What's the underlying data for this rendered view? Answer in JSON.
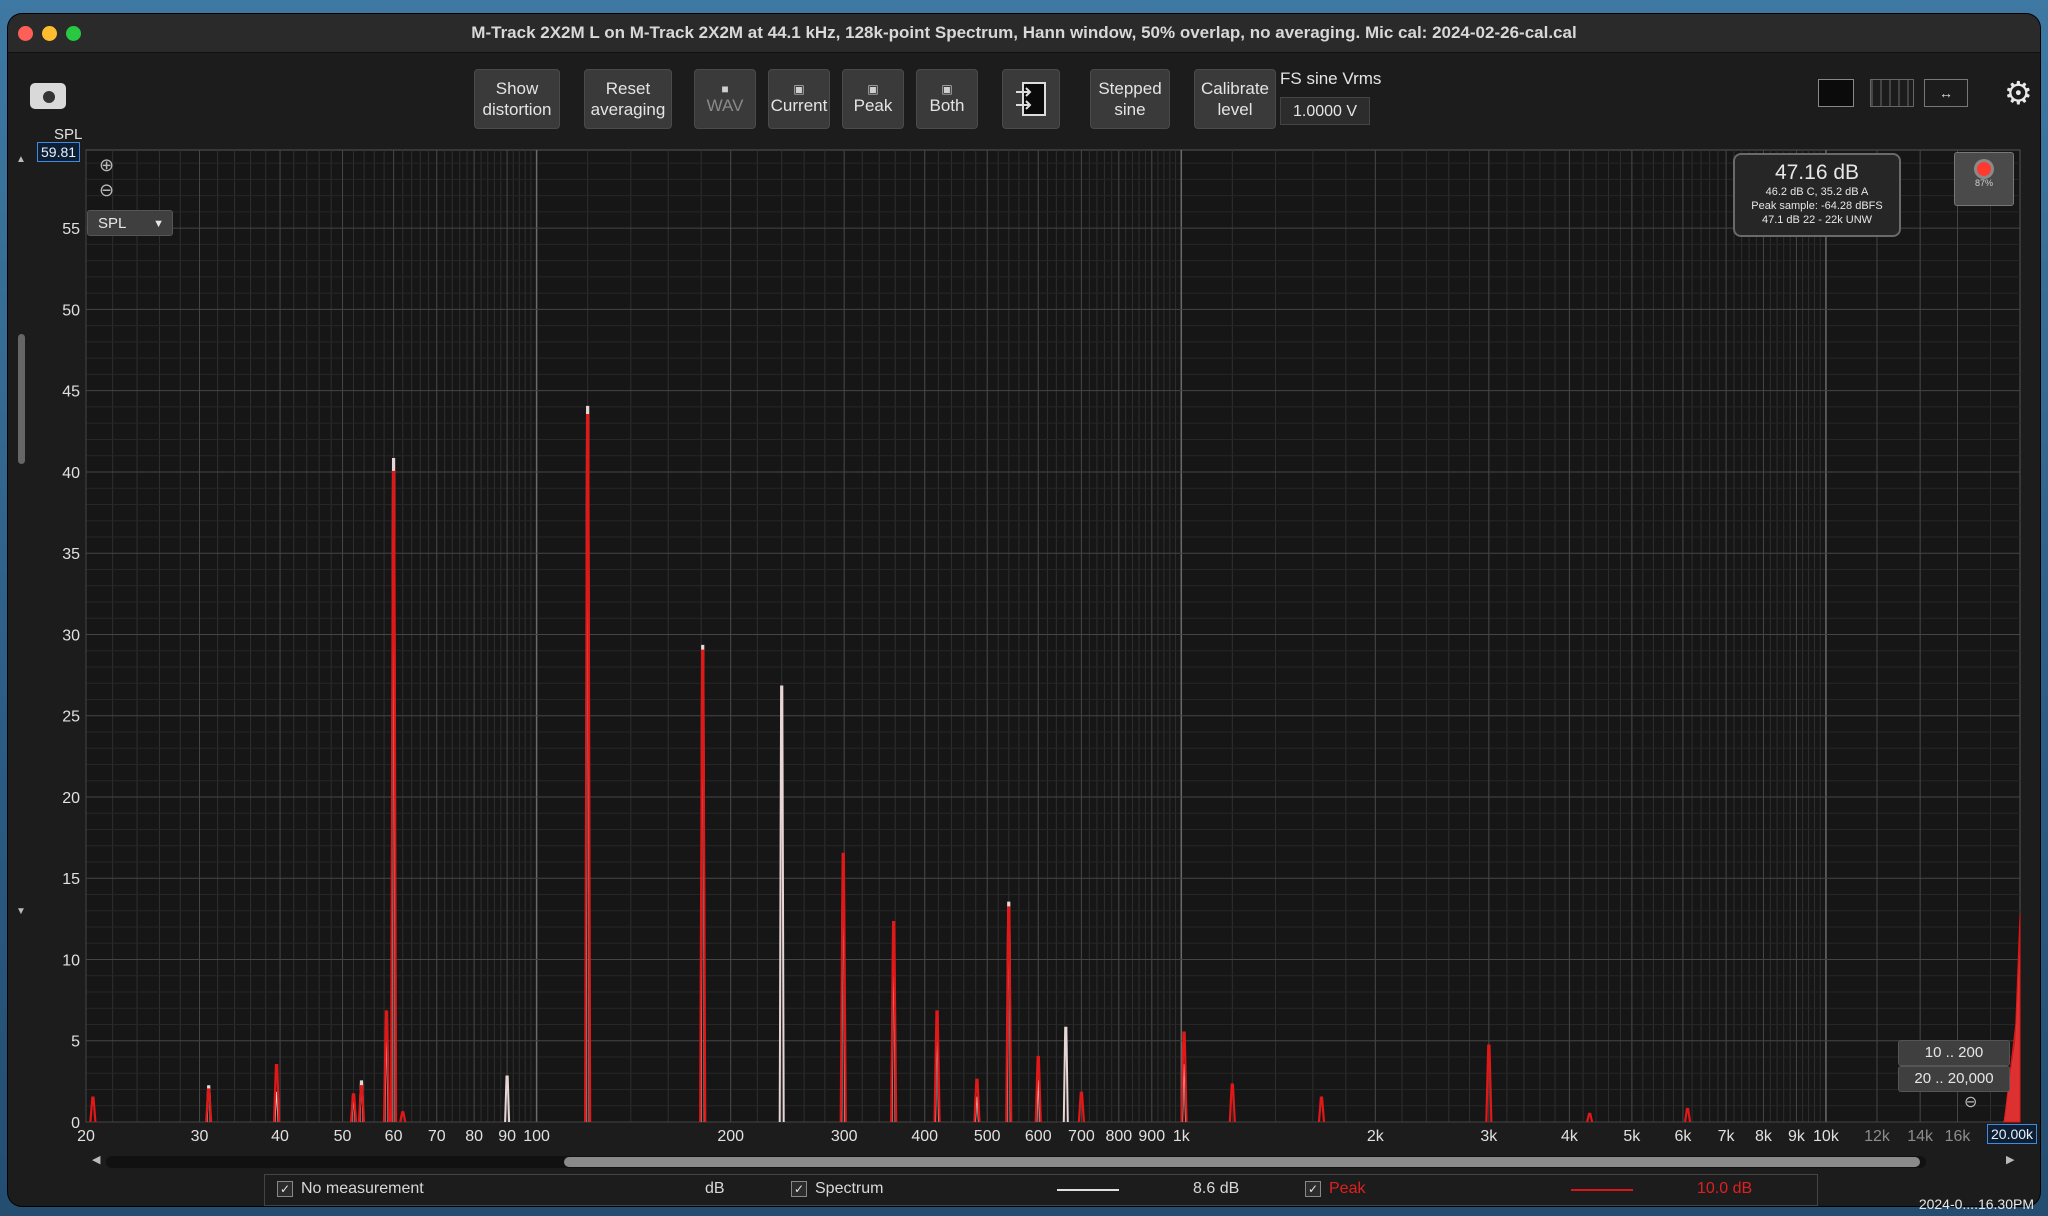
{
  "window": {
    "title": "M-Track 2X2M  L on M-Track 2X2M at 44.1 kHz, 128k-point Spectrum, Hann window, 50% overlap, no averaging. Mic cal: 2024-02-26-cal.cal"
  },
  "toolbar": {
    "show_distortion": [
      "Show",
      "distortion"
    ],
    "reset_averaging": [
      "Reset",
      "averaging"
    ],
    "wav": "WAV",
    "current": "Current",
    "peak": "Peak",
    "both": "Both",
    "stepped_sine": [
      "Stepped",
      "sine"
    ],
    "calibrate_level": [
      "Calibrate",
      "level"
    ],
    "fs_label": "FS sine Vrms",
    "fs_value": "1.0000 V"
  },
  "plot": {
    "spl_axis_label": "SPL",
    "top_value": "59.81",
    "right_value": "20.00k",
    "unit_select": "SPL",
    "readout": {
      "main": "47.16 dB",
      "line1": "46.2 dB C, 35.2 dB A",
      "line2": "Peak sample: -64.28 dBFS",
      "line3": "47.1 dB 22 - 22k UNW"
    },
    "rec_percent": "87%",
    "range_buttons": [
      "10 .. 200",
      "20 .. 20,000"
    ]
  },
  "legend": {
    "no_measurement": "No measurement",
    "unit": "dB",
    "spectrum_label": "Spectrum",
    "spectrum_value": "8.6 dB",
    "peak_label": "Peak",
    "peak_value": "10.0 dB"
  },
  "status": {
    "clock": "2024-0....16.30PM"
  },
  "colors": {
    "spectrum": "#e8d6d6",
    "peak": "#e01818",
    "grid_major": "#454545",
    "grid_minor": "#2f2f2f",
    "accent": "#3f8be0"
  },
  "chart_data": {
    "type": "line",
    "title": "",
    "xlabel": "",
    "ylabel": "SPL",
    "x_scale": "log",
    "xlim": [
      20,
      20000
    ],
    "ylim": [
      0,
      59.81
    ],
    "grid": true,
    "x_tick_labels": [
      {
        "v": 20,
        "t": "20"
      },
      {
        "v": 30,
        "t": "30"
      },
      {
        "v": 40,
        "t": "40"
      },
      {
        "v": 50,
        "t": "50"
      },
      {
        "v": 60,
        "t": "60"
      },
      {
        "v": 70,
        "t": "70"
      },
      {
        "v": 80,
        "t": "80"
      },
      {
        "v": 90,
        "t": "90"
      },
      {
        "v": 100,
        "t": "100"
      },
      {
        "v": 200,
        "t": "200"
      },
      {
        "v": 300,
        "t": "300"
      },
      {
        "v": 400,
        "t": "400"
      },
      {
        "v": 500,
        "t": "500"
      },
      {
        "v": 600,
        "t": "600"
      },
      {
        "v": 700,
        "t": "700"
      },
      {
        "v": 800,
        "t": "800"
      },
      {
        "v": 900,
        "t": "900"
      },
      {
        "v": 1000,
        "t": "1k"
      },
      {
        "v": 2000,
        "t": "2k"
      },
      {
        "v": 3000,
        "t": "3k"
      },
      {
        "v": 4000,
        "t": "4k"
      },
      {
        "v": 5000,
        "t": "5k"
      },
      {
        "v": 6000,
        "t": "6k"
      },
      {
        "v": 7000,
        "t": "7k"
      },
      {
        "v": 8000,
        "t": "8k"
      },
      {
        "v": 9000,
        "t": "9k"
      },
      {
        "v": 10000,
        "t": "10k"
      },
      {
        "v": 12000,
        "t": "12k"
      },
      {
        "v": 14000,
        "t": "14k"
      },
      {
        "v": 16000,
        "t": "16k"
      }
    ],
    "y_ticks": [
      0,
      5,
      10,
      15,
      20,
      25,
      30,
      35,
      40,
      45,
      50,
      55
    ],
    "series": [
      {
        "name": "Spectrum",
        "peaks": [
          {
            "f": 31,
            "db": 2.2
          },
          {
            "f": 39.5,
            "db": 1.8
          },
          {
            "f": 52,
            "db": 1.6
          },
          {
            "f": 53.5,
            "db": 2.5
          },
          {
            "f": 58.5,
            "db": 6.0
          },
          {
            "f": 60,
            "db": 40.8
          },
          {
            "f": 90,
            "db": 2.8
          },
          {
            "f": 120,
            "db": 44.0
          },
          {
            "f": 181,
            "db": 29.3
          },
          {
            "f": 240,
            "db": 26.8
          },
          {
            "f": 299,
            "db": 15.5
          },
          {
            "f": 358,
            "db": 11.0
          },
          {
            "f": 418,
            "db": 5.5
          },
          {
            "f": 482,
            "db": 1.5
          },
          {
            "f": 540,
            "db": 13.5
          },
          {
            "f": 600,
            "db": 2.5
          },
          {
            "f": 662,
            "db": 5.8
          },
          {
            "f": 1010,
            "db": 3.5
          }
        ],
        "hf_rise": [
          {
            "f": 18900,
            "db": 0
          },
          {
            "f": 19700,
            "db": 5
          },
          {
            "f": 20000,
            "db": 10.5
          }
        ]
      },
      {
        "name": "Peak",
        "peaks": [
          {
            "f": 20.5,
            "db": 1.5
          },
          {
            "f": 31,
            "db": 2.0
          },
          {
            "f": 39.5,
            "db": 3.5
          },
          {
            "f": 52,
            "db": 1.7
          },
          {
            "f": 53.5,
            "db": 2.2
          },
          {
            "f": 58.5,
            "db": 6.8
          },
          {
            "f": 60,
            "db": 40.0
          },
          {
            "f": 62,
            "db": 0.6
          },
          {
            "f": 120,
            "db": 43.5
          },
          {
            "f": 181,
            "db": 29.0
          },
          {
            "f": 299,
            "db": 16.5
          },
          {
            "f": 358,
            "db": 12.3
          },
          {
            "f": 418,
            "db": 6.8
          },
          {
            "f": 482,
            "db": 2.6
          },
          {
            "f": 540,
            "db": 13.2
          },
          {
            "f": 600,
            "db": 4.0
          },
          {
            "f": 700,
            "db": 1.8
          },
          {
            "f": 1010,
            "db": 5.5
          },
          {
            "f": 1200,
            "db": 2.3
          },
          {
            "f": 1650,
            "db": 1.5
          },
          {
            "f": 3000,
            "db": 4.7
          },
          {
            "f": 4300,
            "db": 0.5
          },
          {
            "f": 6100,
            "db": 0.8
          }
        ],
        "hf_rise": [
          {
            "f": 18900,
            "db": 0
          },
          {
            "f": 19700,
            "db": 6
          },
          {
            "f": 20000,
            "db": 12.8
          }
        ]
      }
    ]
  }
}
